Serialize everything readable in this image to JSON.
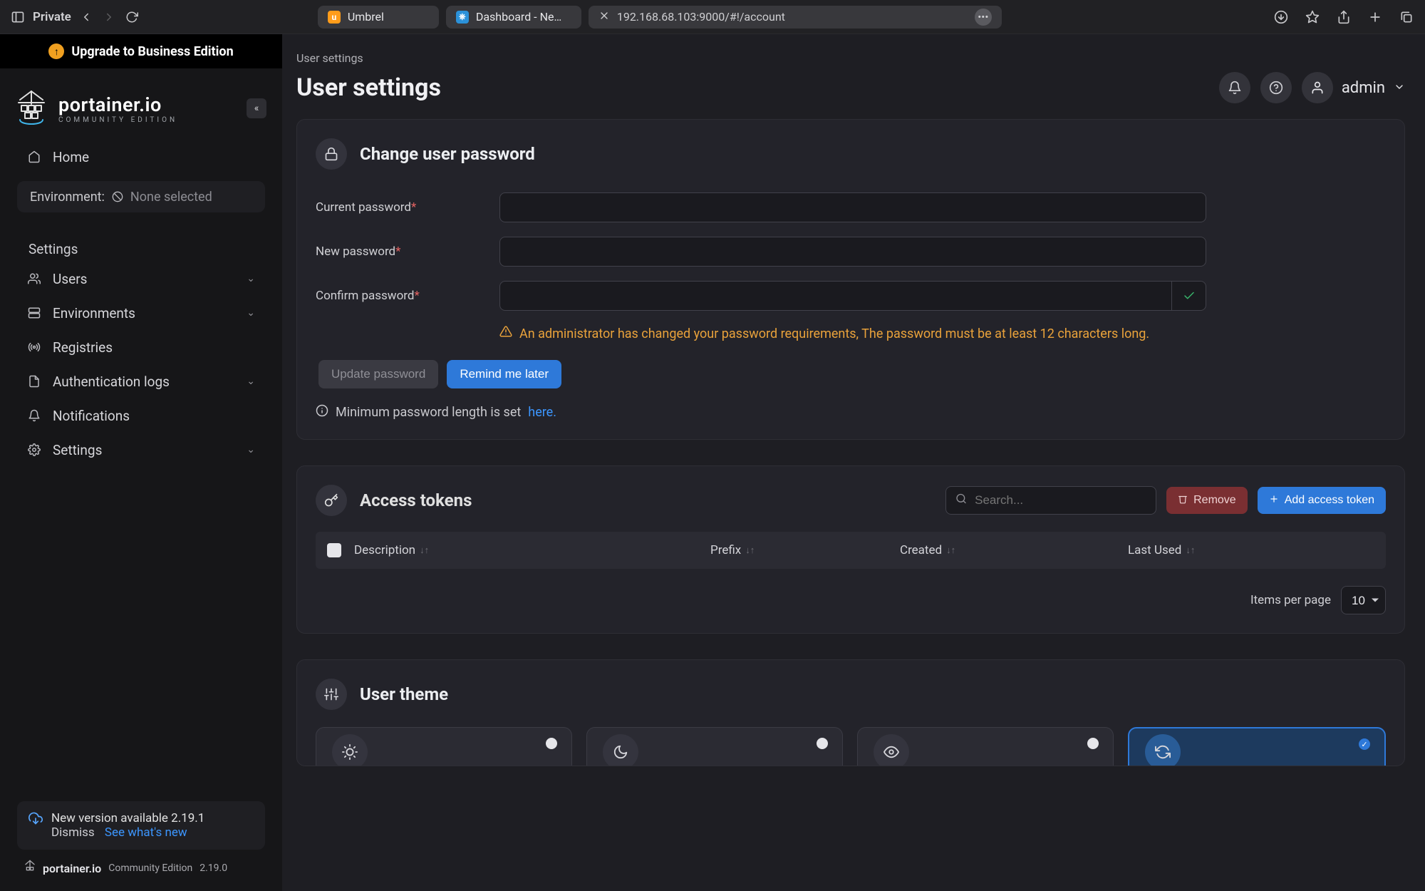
{
  "browser": {
    "private_label": "Private",
    "tabs": [
      {
        "label": "Umbrel"
      },
      {
        "label": "Dashboard - Ne…"
      }
    ],
    "url": "192.168.68.103:9000/#!/account"
  },
  "sidebar": {
    "upgrade_label": "Upgrade to Business Edition",
    "brand": "portainer.io",
    "brand_sub": "COMMUNITY EDITION",
    "home_label": "Home",
    "env_label": "Environment:",
    "env_value": "None selected",
    "settings_label": "Settings",
    "items": [
      {
        "label": "Users"
      },
      {
        "label": "Environments"
      },
      {
        "label": "Registries"
      },
      {
        "label": "Authentication logs"
      },
      {
        "label": "Notifications"
      },
      {
        "label": "Settings"
      }
    ],
    "update": {
      "line1": "New version available 2.19.1",
      "dismiss": "Dismiss",
      "link": "See what's new"
    },
    "footer_brand": "portainer.io",
    "footer_edition": "Community Edition",
    "footer_version": "2.19.0"
  },
  "header": {
    "breadcrumb": "User settings",
    "title": "User settings",
    "user": "admin"
  },
  "password_card": {
    "title": "Change user password",
    "current_label": "Current password",
    "new_label": "New password",
    "confirm_label": "Confirm password",
    "warn": "An administrator has changed your password requirements, The password must be at least 12 characters long.",
    "btn_update": "Update password",
    "btn_remind": "Remind me later",
    "info_prefix": "Minimum password length is set ",
    "info_link": "here."
  },
  "tokens_card": {
    "title": "Access tokens",
    "search_placeholder": "Search...",
    "btn_remove": "Remove",
    "btn_add": "Add access token",
    "cols": {
      "description": "Description",
      "prefix": "Prefix",
      "created": "Created",
      "last_used": "Last Used"
    },
    "items_per_page_label": "Items per page",
    "items_per_page_value": "10"
  },
  "theme_card": {
    "title": "User theme"
  }
}
